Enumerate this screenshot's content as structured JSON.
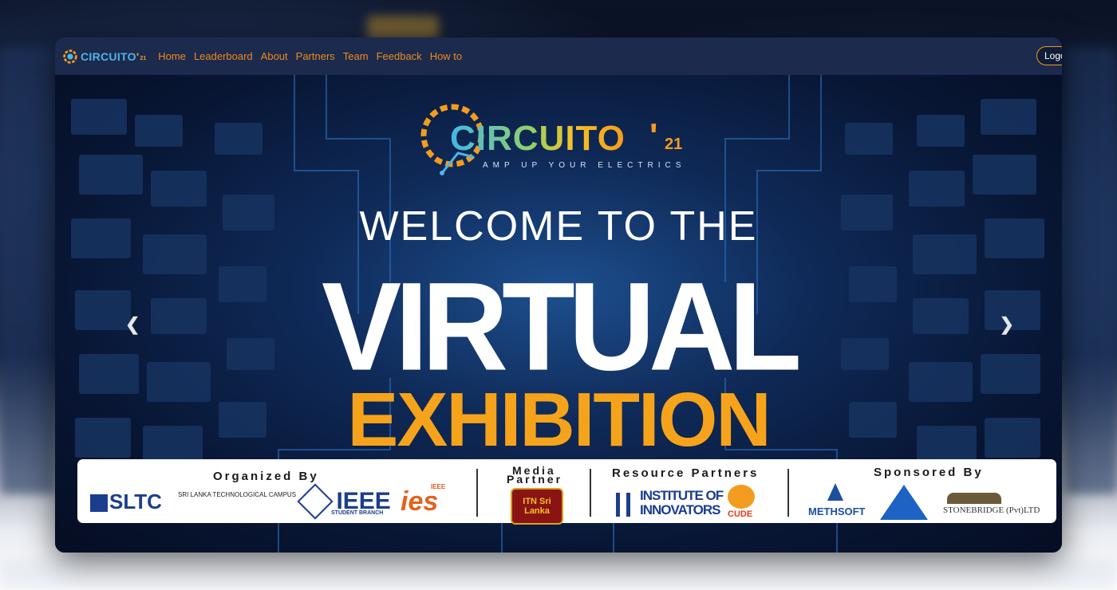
{
  "navbar": {
    "brand": {
      "name": "CIRCUITO",
      "apostrophe": "'",
      "year": "21"
    },
    "links": [
      "Home",
      "Leaderboard",
      "About",
      "Partners",
      "Team",
      "Feedback",
      "How to"
    ],
    "logout_label": "Logo"
  },
  "hero": {
    "logo": {
      "name": "CIRCUITO",
      "apostrophe": "'",
      "year": "21",
      "tagline": "AMP UP YOUR ELECTRICS"
    },
    "welcome": "WELCOME TO THE",
    "virtual": "VIRTUAL",
    "exhibition": "EXHIBITION",
    "prev_icon": "chevron-left-icon",
    "next_icon": "chevron-right-icon"
  },
  "sponsors": {
    "organized_by": {
      "title": "Organized By",
      "logos": {
        "sltc": "SLTC",
        "sltc_text": "SRI LANKA TECHNOLOGICAL CAMPUS",
        "ieee": "IEEE",
        "ieee_sub": "STUDENT BRANCH",
        "ies": "ies",
        "ies_small": "IEEE"
      }
    },
    "media_partner": {
      "title_line1": "Media",
      "title_line2": "Partner",
      "logo": "ITN Sri Lanka"
    },
    "resource_partners": {
      "title": "Resource Partners",
      "logos": {
        "ioi_line1": "INSTITUTE OF",
        "ioi_line2": "INNOVATORS",
        "cude": "CUDE"
      }
    },
    "sponsored_by": {
      "title": "Sponsored By",
      "logos": {
        "methsoft": "METHSOFT",
        "stonebridge": "STONEBRIDGE (Pvt)LTD"
      }
    }
  },
  "colors": {
    "accent": "#f39c1e",
    "navbar": "#1c2a4e",
    "link": "#f08a1c",
    "cyan": "#4fb3e8"
  }
}
